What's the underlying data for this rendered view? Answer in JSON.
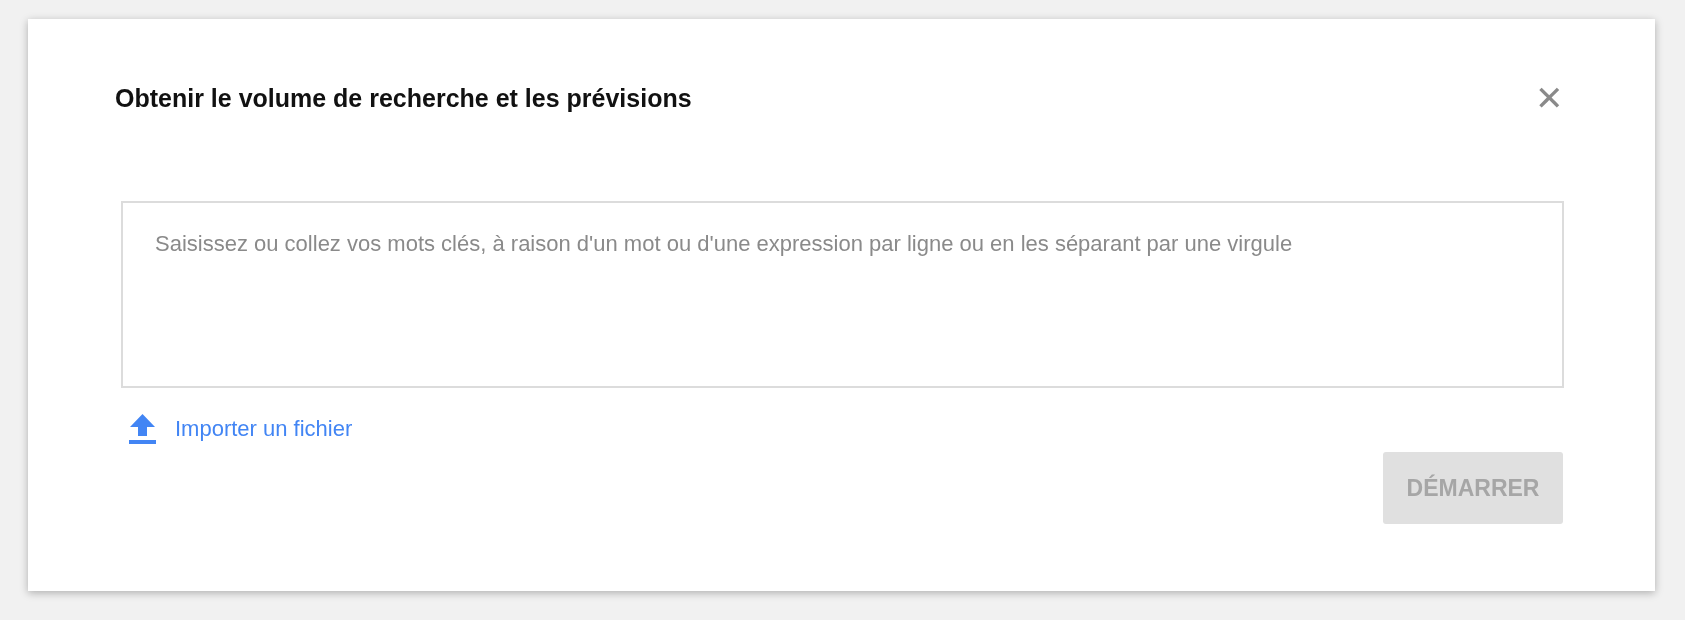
{
  "dialog": {
    "title": "Obtenir le volume de recherche et les prévisions",
    "close_label": "✕"
  },
  "keywords_field": {
    "placeholder": "Saisissez ou collez vos mots clés, à raison d'un mot ou d'une expression par ligne ou en les séparant par une virgule"
  },
  "upload_link": {
    "label": "Importer un fichier"
  },
  "start_button": {
    "label": "DÉMARRER",
    "disabled": true
  }
}
